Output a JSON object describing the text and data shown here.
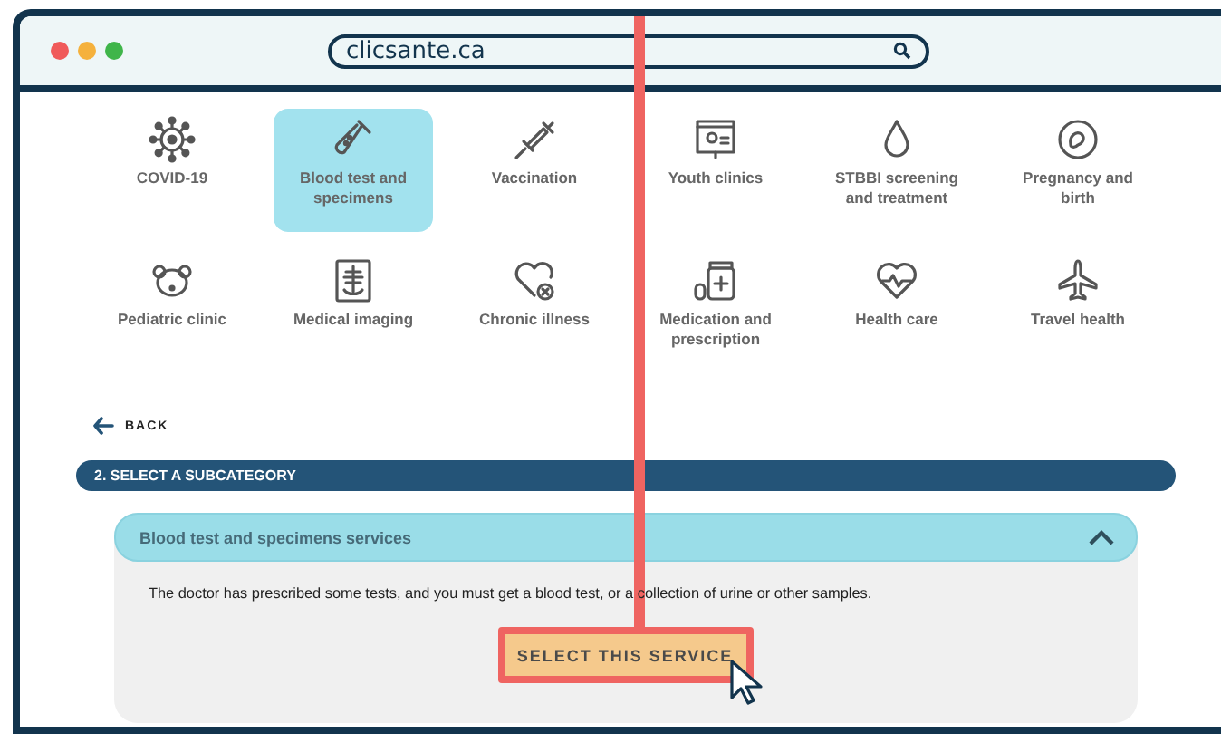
{
  "browser": {
    "address": "clicsante.ca"
  },
  "categories": [
    {
      "label": "COVID-19",
      "selected": false
    },
    {
      "label": "Blood test and specimens",
      "selected": true
    },
    {
      "label": "Vaccination",
      "selected": false
    },
    {
      "label": "Youth clinics",
      "selected": false
    },
    {
      "label": "STBBI screening and treatment",
      "selected": false
    },
    {
      "label": "Pregnancy and birth",
      "selected": false
    },
    {
      "label": "Pediatric clinic",
      "selected": false
    },
    {
      "label": "Medical imaging",
      "selected": false
    },
    {
      "label": "Chronic illness",
      "selected": false
    },
    {
      "label": "Medication and prescription",
      "selected": false
    },
    {
      "label": "Health care",
      "selected": false
    },
    {
      "label": "Travel health",
      "selected": false
    }
  ],
  "back": "BACK",
  "section_title": "2. SELECT A SUBCATEGORY",
  "subcategory": {
    "title": "Blood test and specimens services",
    "expanded": true,
    "description": "The doctor has prescribed some tests, and you must get a blood test, or a collection of urine or other samples.",
    "button": "SELECT THIS SERVICE"
  }
}
